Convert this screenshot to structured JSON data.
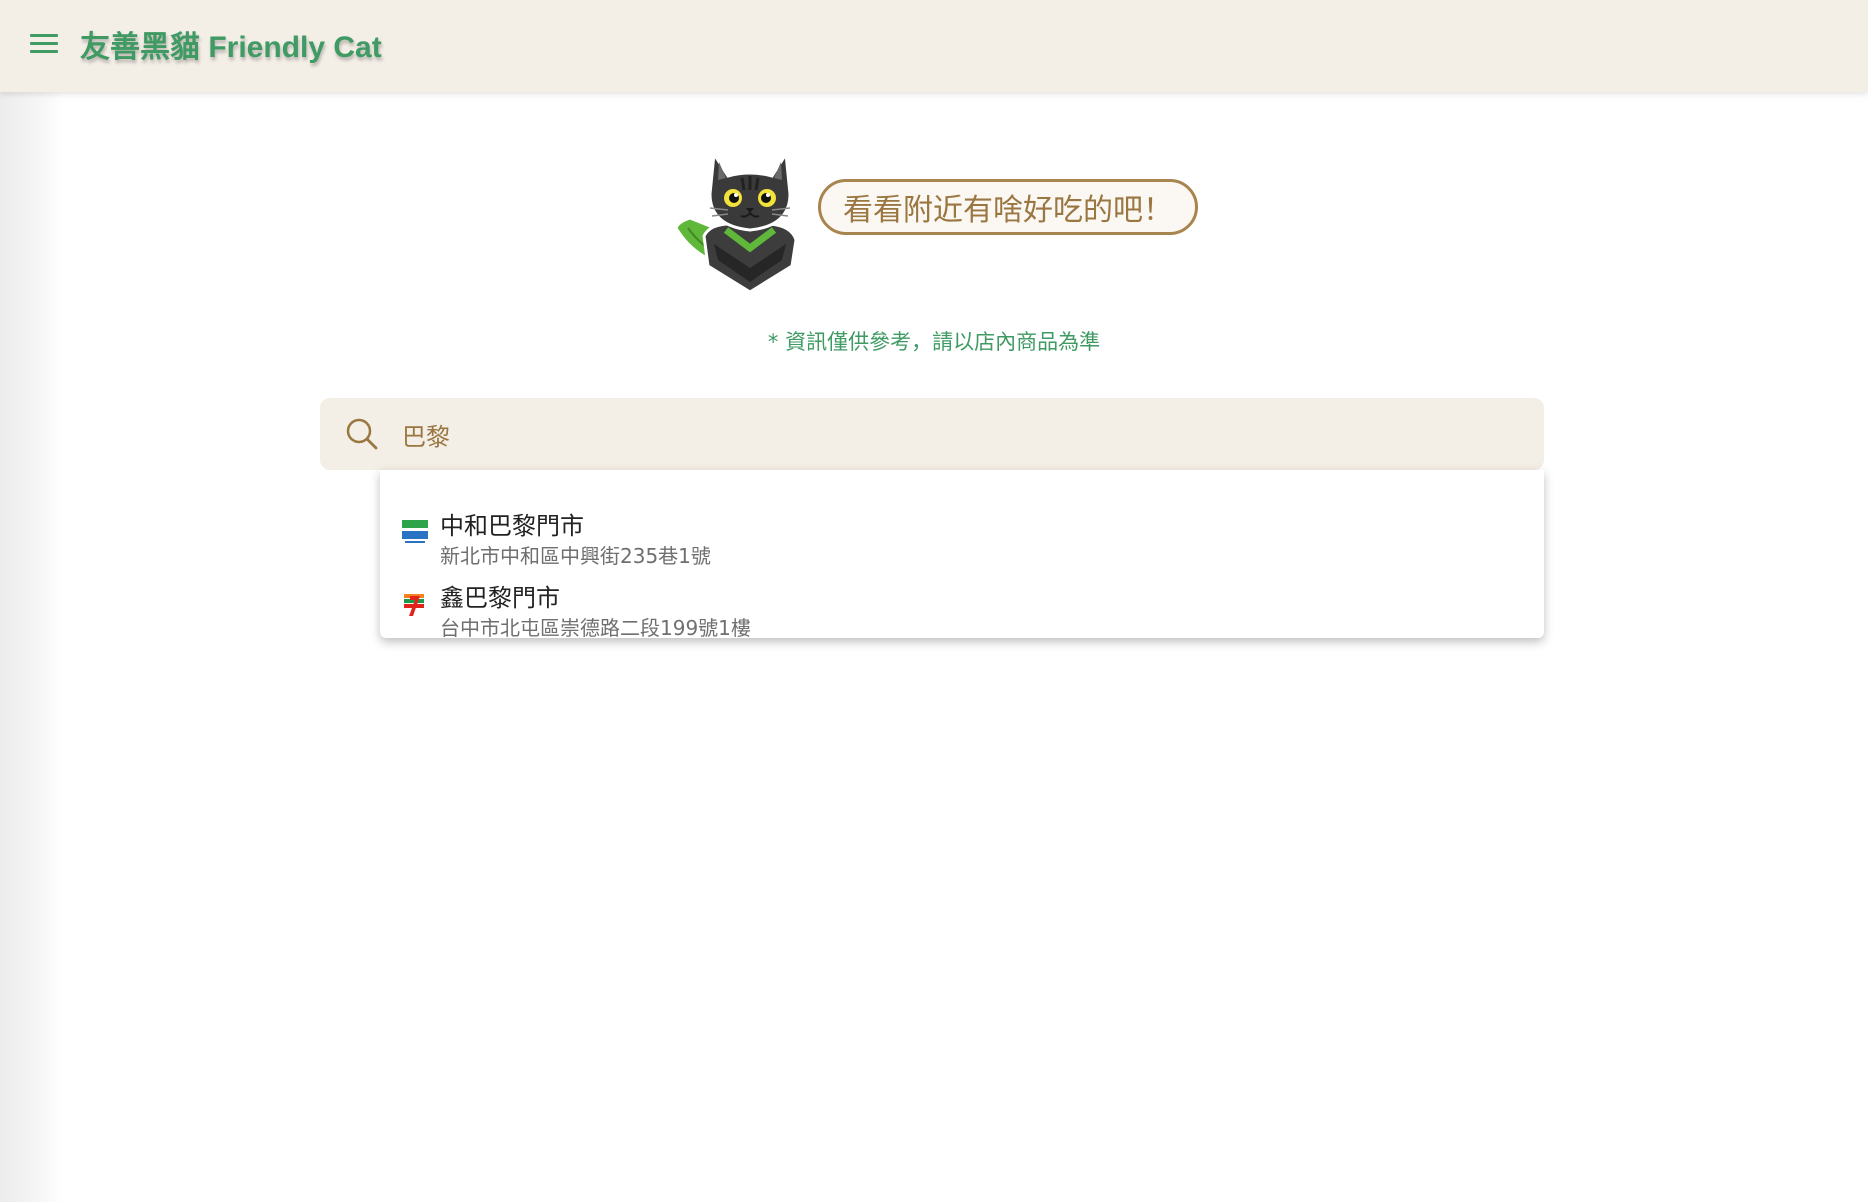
{
  "header": {
    "title": "友善黑貓 Friendly Cat",
    "menu_icon": "hamburger-menu-icon",
    "background": "#f3eee6",
    "accent": "#3f9a63"
  },
  "hero": {
    "mascot_icon": "black-cat-mascot-icon",
    "speech": "看看附近有啥好吃的吧！"
  },
  "disclaimer": "* 資訊僅供參考，請以店內商品為準",
  "search": {
    "icon": "search-icon",
    "value": "巴黎",
    "placeholder": ""
  },
  "results": [
    {
      "name": "中和巴黎門市",
      "address": "新北市中和區中興街235巷1號",
      "brand_icon": "familymart-logo-icon"
    },
    {
      "name": "鑫巴黎門市",
      "address": "台中市北屯區崇德路二段199號1樓",
      "brand_icon": "seven-eleven-logo-icon"
    }
  ],
  "colors": {
    "primary_green": "#3f9a63",
    "tan": "#9a7640",
    "surface": "#f3eee6"
  }
}
